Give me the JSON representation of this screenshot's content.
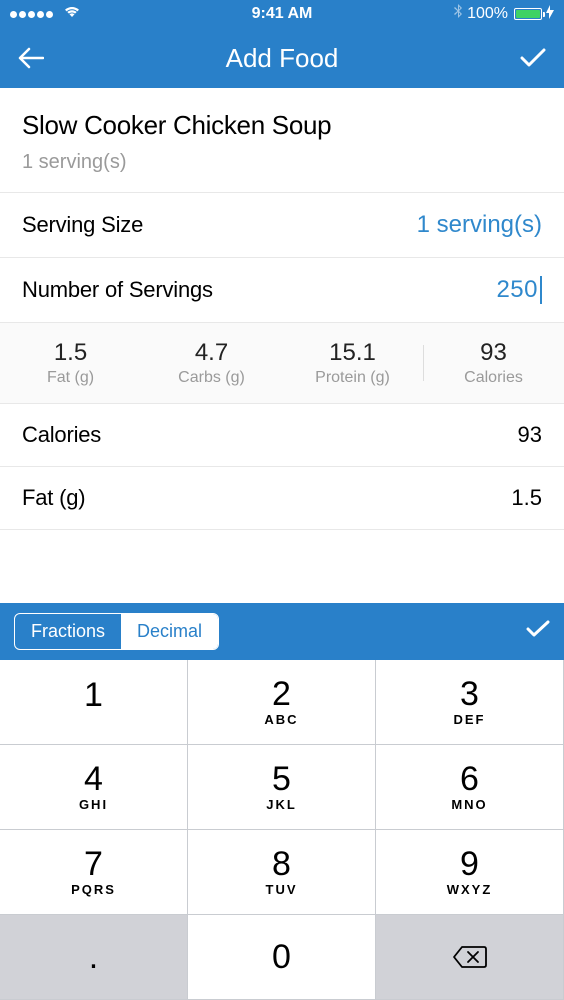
{
  "status": {
    "time": "9:41 AM",
    "battery": "100%"
  },
  "nav": {
    "title": "Add Food"
  },
  "food": {
    "name": "Slow Cooker Chicken Soup",
    "subtitle": "1 serving(s)"
  },
  "serving_size": {
    "label": "Serving Size",
    "value": "1 serving(s)"
  },
  "num_servings": {
    "label": "Number of Servings",
    "value": "250"
  },
  "macros": [
    {
      "value": "1.5",
      "label": "Fat (g)"
    },
    {
      "value": "4.7",
      "label": "Carbs (g)"
    },
    {
      "value": "15.1",
      "label": "Protein (g)"
    },
    {
      "value": "93",
      "label": "Calories"
    }
  ],
  "details": [
    {
      "label": "Calories",
      "value": "93"
    },
    {
      "label": "Fat (g)",
      "value": "1.5"
    }
  ],
  "mode": {
    "fractions": "Fractions",
    "decimal": "Decimal"
  },
  "keypad": [
    {
      "num": "1",
      "sub": ""
    },
    {
      "num": "2",
      "sub": "ABC"
    },
    {
      "num": "3",
      "sub": "DEF"
    },
    {
      "num": "4",
      "sub": "GHI"
    },
    {
      "num": "5",
      "sub": "JKL"
    },
    {
      "num": "6",
      "sub": "MNO"
    },
    {
      "num": "7",
      "sub": "PQRS"
    },
    {
      "num": "8",
      "sub": "TUV"
    },
    {
      "num": "9",
      "sub": "WXYZ"
    },
    {
      "num": ".",
      "sub": ""
    },
    {
      "num": "0",
      "sub": ""
    }
  ]
}
